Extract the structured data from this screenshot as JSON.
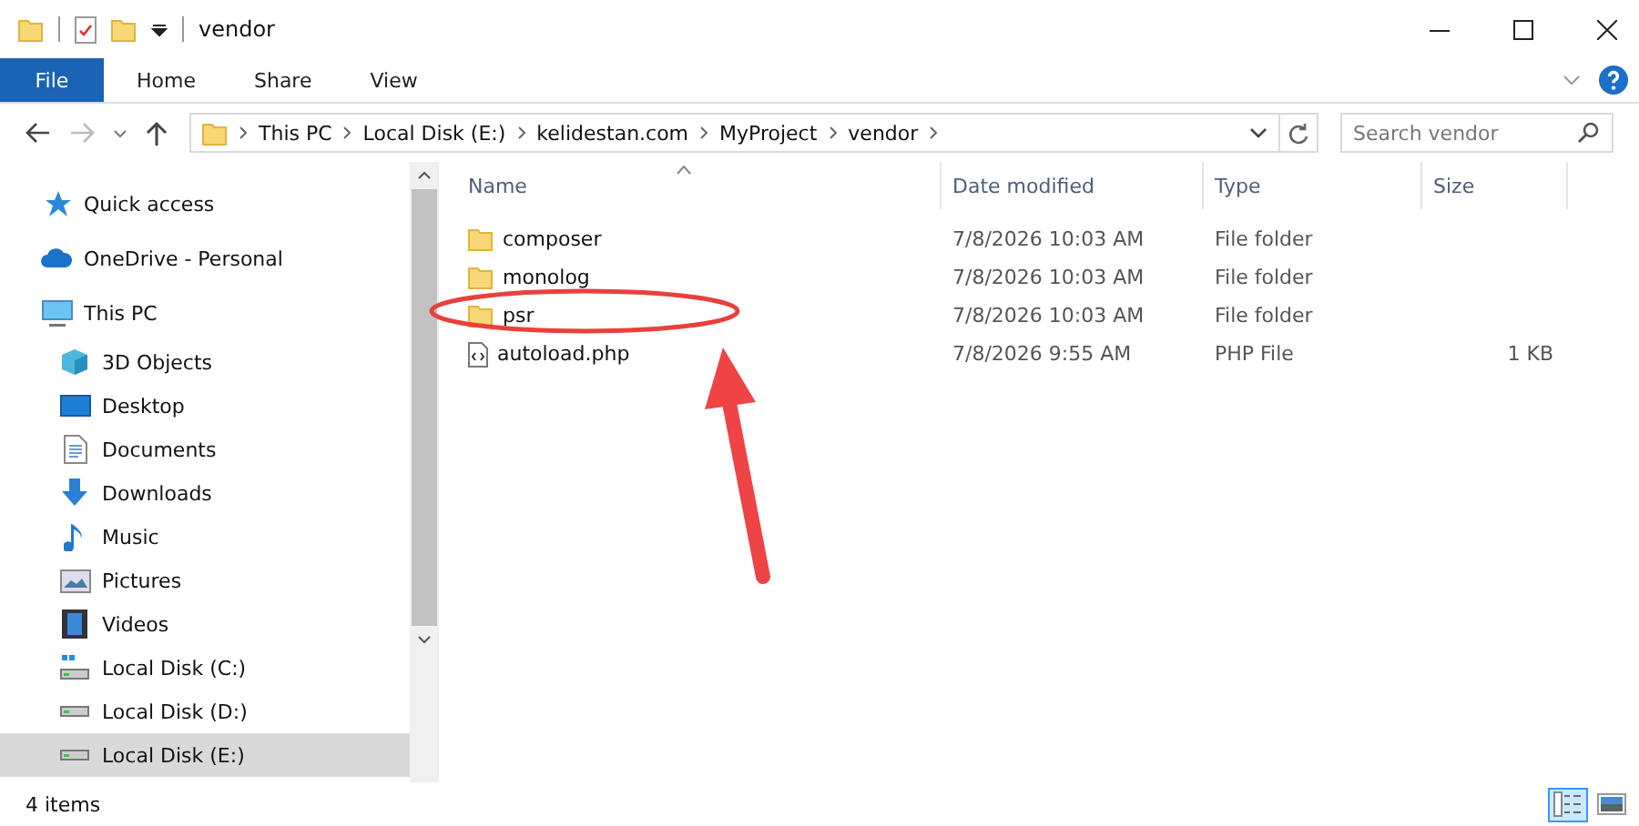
{
  "window": {
    "title": "vendor"
  },
  "ribbon": {
    "tabs": [
      {
        "label": "File",
        "selected": true
      },
      {
        "label": "Home",
        "selected": false
      },
      {
        "label": "Share",
        "selected": false
      },
      {
        "label": "View",
        "selected": false
      }
    ]
  },
  "address_bar": {
    "path": [
      "This PC",
      "Local Disk (E:)",
      "kelidestan.com",
      "MyProject",
      "vendor"
    ]
  },
  "search": {
    "placeholder": "Search vendor"
  },
  "sidebar": {
    "items": [
      {
        "label": "Quick access",
        "kind": "star",
        "selected": false
      },
      {
        "label": "OneDrive - Personal",
        "kind": "cloud",
        "selected": false
      },
      {
        "label": "This PC",
        "kind": "pc",
        "selected": false,
        "children": [
          {
            "label": "3D Objects",
            "kind": "cube",
            "selected": false
          },
          {
            "label": "Desktop",
            "kind": "desktop",
            "selected": false
          },
          {
            "label": "Documents",
            "kind": "doc",
            "selected": false
          },
          {
            "label": "Downloads",
            "kind": "download",
            "selected": false
          },
          {
            "label": "Music",
            "kind": "music",
            "selected": false
          },
          {
            "label": "Pictures",
            "kind": "pictures",
            "selected": false
          },
          {
            "label": "Videos",
            "kind": "videos",
            "selected": false
          },
          {
            "label": "Local Disk (C:)",
            "kind": "system-drive",
            "selected": false
          },
          {
            "label": "Local Disk (D:)",
            "kind": "drive",
            "selected": false
          },
          {
            "label": "Local Disk (E:)",
            "kind": "drive",
            "selected": true
          }
        ]
      }
    ]
  },
  "table": {
    "columns": [
      "Name",
      "Date modified",
      "Type",
      "Size"
    ],
    "rows": [
      {
        "kind": "folder",
        "name": "composer",
        "date": "7/8/2026 10:03 AM",
        "type": "File folder"
      },
      {
        "kind": "folder",
        "name": "monolog",
        "date": "7/8/2026 10:03 AM",
        "type": "File folder"
      },
      {
        "kind": "folder",
        "name": "psr",
        "date": "7/8/2026 10:03 AM",
        "type": "File folder"
      },
      {
        "kind": "file",
        "name": "autoload.php",
        "date": "7/8/2026 9:55 AM",
        "type": "PHP File",
        "size": "1 KB"
      }
    ]
  },
  "status_bar": {
    "text": "4 items",
    "views": [
      {
        "kind": "details",
        "selected": true
      },
      {
        "kind": "thumbnails",
        "selected": false
      }
    ]
  }
}
